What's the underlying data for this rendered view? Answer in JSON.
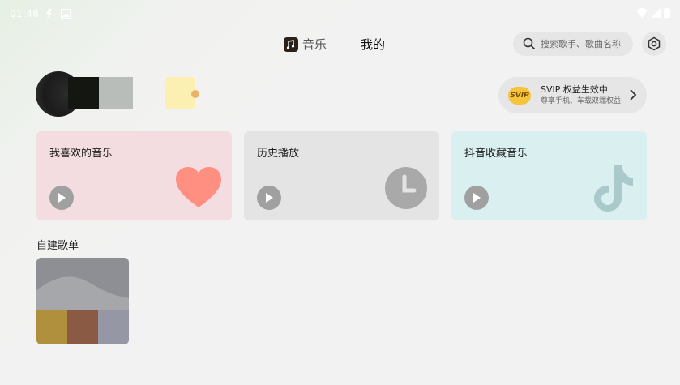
{
  "status_bar": {
    "time": "01:48"
  },
  "tabs": [
    {
      "label": "音乐"
    },
    {
      "label": "我的"
    }
  ],
  "search": {
    "placeholder": "搜索歌手、歌曲名称"
  },
  "svip": {
    "logo_text": "SVIP",
    "title": "SVIP 权益生效中",
    "subtitle": "尊享手机、车载双端权益"
  },
  "cards": [
    {
      "title": "我喜欢的音乐",
      "bg": "#f4dde1",
      "icon": "heart-icon",
      "icon_color": "#ff8f80"
    },
    {
      "title": "历史播放",
      "bg": "#e4e4e4",
      "icon": "clock-icon",
      "icon_color": "#a9a9a9"
    },
    {
      "title": "抖音收藏音乐",
      "bg": "#d9eff0",
      "icon": "tiktok-icon",
      "icon_color": "#a9c9cb"
    }
  ],
  "section": {
    "title": "自建歌单"
  },
  "colors": {
    "accent_gold": "#f6c43b",
    "play_button": "#a0a0a0"
  }
}
